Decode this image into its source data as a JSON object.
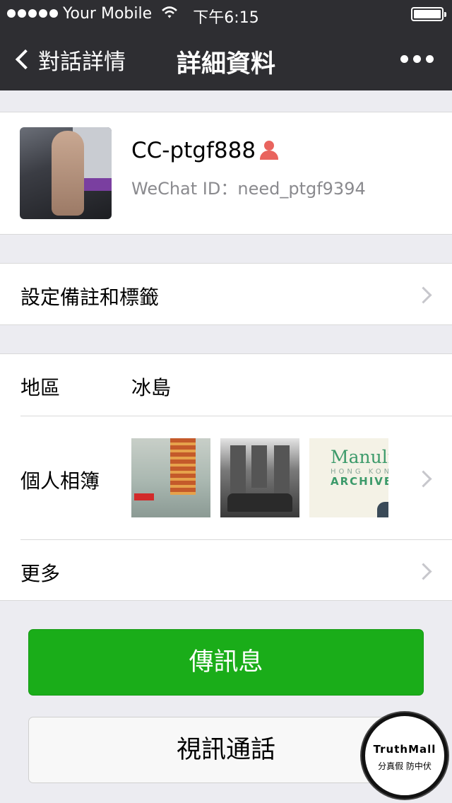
{
  "status_bar": {
    "carrier": "Your Mobile",
    "time": "下午6:15",
    "icons": [
      "signal-dots-icon",
      "wifi-icon",
      "battery-icon"
    ]
  },
  "nav": {
    "back_label": "對話詳情",
    "title": "詳細資料",
    "more_icon": "more-dots-icon"
  },
  "profile": {
    "name": "CC-ptgf888",
    "gender_icon": "female-person-icon",
    "gender_icon_color": "#e9645e",
    "wechat_id": "WeChat ID：need_ptgf9394"
  },
  "remark_row": {
    "label": "設定備註和標籤"
  },
  "info": {
    "region_label": "地區",
    "region_value": "冰島",
    "album_label": "個人相簿",
    "album_thumbnail_text": {
      "line1": "Manulife",
      "line2": "HONG KONG",
      "line3": "ARCHIVES"
    },
    "more_label": "更多"
  },
  "actions": {
    "send_message": "傳訊息",
    "video_call": "視訊通話",
    "send_color": "#1aad19"
  },
  "watermark": {
    "brand": "TruthMall",
    "tagline": "分真假 防中伏"
  }
}
